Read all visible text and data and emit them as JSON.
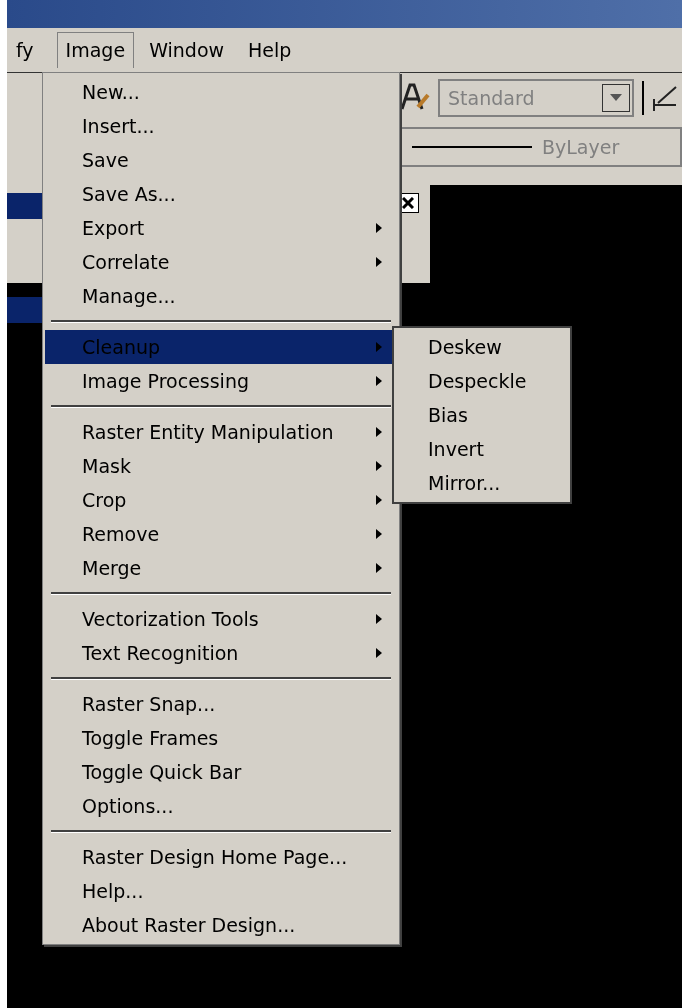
{
  "menubar": [
    {
      "label": "fy",
      "selected": false
    },
    {
      "label": "Image",
      "selected": true
    },
    {
      "label": "Window",
      "selected": false
    },
    {
      "label": "Help",
      "selected": false
    }
  ],
  "toolbar": {
    "text_style": "Standard",
    "linetype": "ByLayer"
  },
  "menu": {
    "sections": [
      [
        {
          "label": "New...",
          "submenu": false,
          "selected": false
        },
        {
          "label": "Insert...",
          "submenu": false,
          "selected": false
        },
        {
          "label": "Save",
          "submenu": false,
          "selected": false
        },
        {
          "label": "Save As...",
          "submenu": false,
          "selected": false
        },
        {
          "label": "Export",
          "submenu": true,
          "selected": false
        },
        {
          "label": "Correlate",
          "submenu": true,
          "selected": false
        },
        {
          "label": "Manage...",
          "submenu": false,
          "selected": false
        }
      ],
      [
        {
          "label": "Cleanup",
          "submenu": true,
          "selected": true
        },
        {
          "label": "Image Processing",
          "submenu": true,
          "selected": false
        }
      ],
      [
        {
          "label": "Raster Entity Manipulation",
          "submenu": true,
          "selected": false
        },
        {
          "label": "Mask",
          "submenu": true,
          "selected": false
        },
        {
          "label": "Crop",
          "submenu": true,
          "selected": false
        },
        {
          "label": "Remove",
          "submenu": true,
          "selected": false
        },
        {
          "label": "Merge",
          "submenu": true,
          "selected": false
        }
      ],
      [
        {
          "label": "Vectorization Tools",
          "submenu": true,
          "selected": false
        },
        {
          "label": "Text Recognition",
          "submenu": true,
          "selected": false
        }
      ],
      [
        {
          "label": "Raster Snap...",
          "submenu": false,
          "selected": false
        },
        {
          "label": "Toggle Frames",
          "submenu": false,
          "selected": false
        },
        {
          "label": "Toggle Quick Bar",
          "submenu": false,
          "selected": false
        },
        {
          "label": "Options...",
          "submenu": false,
          "selected": false
        }
      ],
      [
        {
          "label": "Raster Design Home Page...",
          "submenu": false,
          "selected": false
        },
        {
          "label": "Help...",
          "submenu": false,
          "selected": false
        },
        {
          "label": "About Raster Design...",
          "submenu": false,
          "selected": false
        }
      ]
    ]
  },
  "submenu": {
    "items": [
      "Deskew",
      "Despeckle",
      "Bias",
      "Invert",
      "Mirror..."
    ]
  }
}
